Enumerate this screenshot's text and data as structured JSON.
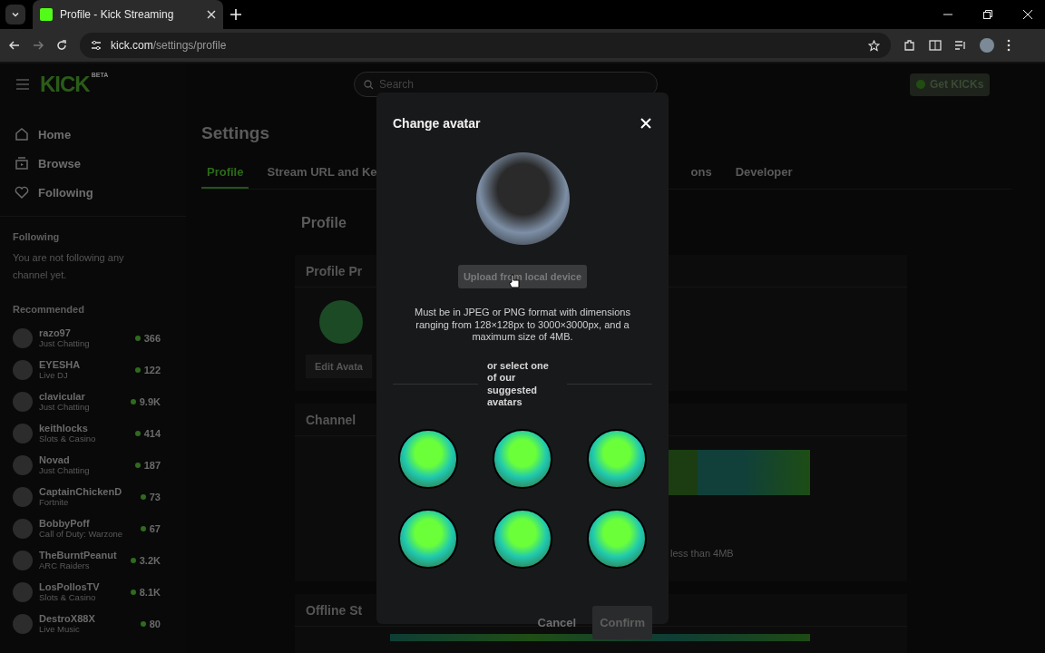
{
  "browser": {
    "tab_title": "Profile - Kick Streaming",
    "url_host": "kick.com",
    "url_path": "/settings/profile"
  },
  "header": {
    "logo": "KICK",
    "logo_badge": "BETA",
    "search_placeholder": "Search",
    "get_kicks": "Get KICKs"
  },
  "sidebar": {
    "nav": [
      {
        "label": "Home",
        "kind": "home"
      },
      {
        "label": "Browse",
        "kind": "browse"
      },
      {
        "label": "Following",
        "kind": "following"
      }
    ],
    "following": {
      "heading": "Following",
      "empty": "You are not following any channel yet."
    },
    "recommended": {
      "heading": "Recommended",
      "channels": [
        {
          "name": "razo97",
          "category": "Just Chatting",
          "viewers": "366"
        },
        {
          "name": "EYESHA",
          "category": "Live DJ",
          "viewers": "122"
        },
        {
          "name": "clavicular",
          "category": "Just Chatting",
          "viewers": "9.9K"
        },
        {
          "name": "keithlocks",
          "category": "Slots & Casino",
          "viewers": "414"
        },
        {
          "name": "Novad",
          "category": "Just Chatting",
          "viewers": "187"
        },
        {
          "name": "CaptainChickenD",
          "category": "Fortnite",
          "viewers": "73"
        },
        {
          "name": "BobbyPoff",
          "category": "Call of Duty: Warzone",
          "viewers": "67"
        },
        {
          "name": "TheBurntPeanut",
          "category": "ARC Raiders",
          "viewers": "3.2K"
        },
        {
          "name": "LosPollosTV",
          "category": "Slots & Casino",
          "viewers": "8.1K"
        },
        {
          "name": "DestroX88X",
          "category": "Live Music",
          "viewers": "80"
        }
      ]
    }
  },
  "settings": {
    "title": "Settings",
    "tabs": [
      {
        "label": "Profile",
        "selected": true
      },
      {
        "label": "Stream URL and Ke",
        "selected": false
      },
      {
        "label": "ons",
        "selected": false
      },
      {
        "label": "Developer",
        "selected": false
      }
    ],
    "section_title": "Profile",
    "profile_card_title": "Profile Pr",
    "edit_avatar": "Edit Avata",
    "channel_card_title": "Channel",
    "banner_note": "less than 4MB",
    "offline_card_title": "Offline St"
  },
  "dialog": {
    "title": "Change avatar",
    "upload_button": "Upload from local device",
    "note": "Must be in JPEG or PNG format with dimensions ranging from 128×128px to 3000×3000px, and a maximum size of 4MB.",
    "divider_text": "or select one of our suggested avatars",
    "cancel": "Cancel",
    "confirm": "Confirm",
    "confirm_disabled": true
  }
}
